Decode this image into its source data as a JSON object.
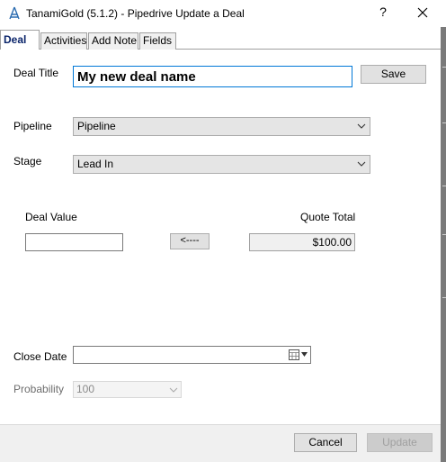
{
  "window": {
    "title": "TanamiGold (5.1.2) - Pipedrive Update a Deal",
    "help_label": "?"
  },
  "tabs": [
    {
      "label": "Deal",
      "active": true
    },
    {
      "label": "Activities",
      "active": false
    },
    {
      "label": "Add Note",
      "active": false
    },
    {
      "label": "Fields",
      "active": false
    }
  ],
  "deal": {
    "title_label": "Deal Title",
    "title_value": "My new deal name",
    "save_label": "Save",
    "pipeline_label": "Pipeline",
    "pipeline_value": "Pipeline",
    "stage_label": "Stage",
    "stage_value": "Lead In",
    "deal_value_label": "Deal Value",
    "deal_value": "",
    "copy_button_label": "<----",
    "quote_total_label": "Quote Total",
    "quote_total_value": "$100.00",
    "close_date_label": "Close Date",
    "close_date_value": "",
    "probability_label": "Probability",
    "probability_value": "100"
  },
  "footer": {
    "cancel_label": "Cancel",
    "update_label": "Update"
  },
  "colors": {
    "active_tab_text": "#0a246a",
    "focus_border": "#0078d7",
    "app_icon": "#2b6cb0"
  }
}
